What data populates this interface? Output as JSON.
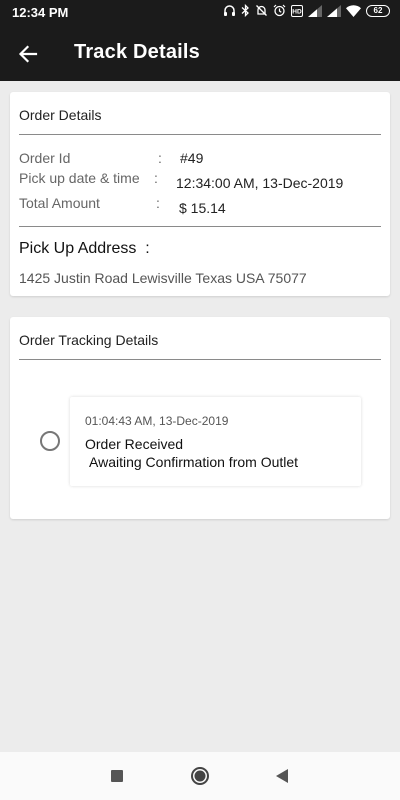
{
  "status_bar": {
    "time": "12:34 PM",
    "battery": "62",
    "icons": [
      "headphones-icon",
      "bluetooth-icon",
      "mute-icon",
      "alarm-icon",
      "hd-icon",
      "signal-icon",
      "signal-icon",
      "wifi-icon",
      "battery-icon"
    ]
  },
  "app_bar": {
    "back_icon": "arrow-left-icon",
    "title": "Track Details"
  },
  "order_details": {
    "title": "Order Details",
    "rows": [
      {
        "label": "Order Id",
        "colon": ":",
        "value": "#49"
      },
      {
        "label": "Pick up date & time",
        "colon": ":",
        "value": "12:34:00 AM, 13-Dec-2019"
      },
      {
        "label": "Total Amount",
        "colon": ":",
        "value": "$ 15.14"
      }
    ],
    "pickup_heading": "Pick Up Address",
    "pickup_colon": ":",
    "pickup_address": "1425 Justin Road Lewisville Texas USA 75077"
  },
  "tracking": {
    "title": "Order Tracking Details",
    "events": [
      {
        "timestamp": "01:04:43 AM, 13-Dec-2019",
        "status": "Order Received",
        "detail": "Awaiting Confirmation from Outlet"
      }
    ]
  },
  "nav_bar": {
    "icons": [
      "recents-square-icon",
      "home-circle-icon",
      "back-triangle-icon"
    ]
  },
  "colors": {
    "app_bar": "#1b1b1b",
    "background": "#ececec",
    "card": "#ffffff"
  }
}
